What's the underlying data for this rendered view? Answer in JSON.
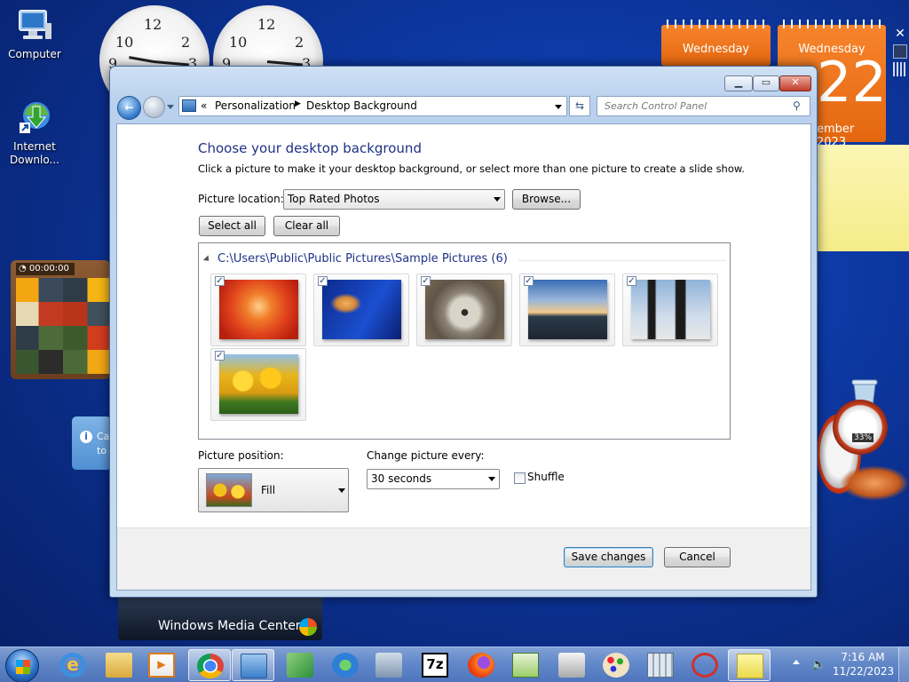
{
  "desktop": {
    "icons": [
      {
        "label_line1": "Computer",
        "label_line2": "",
        "icon": "computer-icon"
      },
      {
        "label_line1": "Internet",
        "label_line2": "Downlo...",
        "icon": "internet-download-manager-icon"
      }
    ],
    "calendar": {
      "small_day": "Wednesday",
      "big_day": "Wednesday",
      "big_date": "22",
      "month_year": "ember 2023"
    },
    "puzzle_timer": "00:00:00",
    "media_center_label": "Windows Media Center",
    "cpu_meter_percent": "33%",
    "gadget_text_fragment": "n",
    "info_fragments": [
      "Ca",
      "to"
    ]
  },
  "window": {
    "nav": {
      "breadcrumb_prefix": "«",
      "crumbs": [
        "Personalization",
        "Desktop Background"
      ],
      "search_placeholder": "Search Control Panel"
    },
    "heading": "Choose your desktop background",
    "instruction": "Click a picture to make it your desktop background, or select more than one picture to create a slide show.",
    "picture_location_label": "Picture location:",
    "picture_location_value": "Top Rated Photos",
    "browse_label": "Browse...",
    "select_all_label": "Select all",
    "clear_all_label": "Clear all",
    "group_header": "C:\\Users\\Public\\Public Pictures\\Sample Pictures (6)",
    "pictures": [
      {
        "name": "chrysanthemum",
        "checked": true
      },
      {
        "name": "jellyfish",
        "checked": true
      },
      {
        "name": "koala",
        "checked": true
      },
      {
        "name": "lighthouse",
        "checked": true
      },
      {
        "name": "penguins",
        "checked": true
      },
      {
        "name": "tulips",
        "checked": true
      }
    ],
    "position_label": "Picture position:",
    "position_value": "Fill",
    "interval_label": "Change picture every:",
    "interval_value": "30 seconds",
    "shuffle_label": "Shuffle",
    "shuffle_checked": false,
    "save_label": "Save changes",
    "cancel_label": "Cancel"
  },
  "taskbar": {
    "apps": [
      "start-orb-icon",
      "internet-explorer-icon",
      "windows-explorer-icon",
      "media-player-icon",
      "chrome-icon",
      "control-panel-icon",
      "system-tools-icon",
      "internet-download-manager-icon",
      "network-icon",
      "7zip-icon",
      "firefox-icon",
      "notepad-plus-icon",
      "printer-icon",
      "paint-icon",
      "calculator-icon",
      "snipping-tool-icon",
      "sticky-notes-icon"
    ],
    "time": "7:16 AM",
    "date": "11/22/2023"
  },
  "colors": {
    "heading": "#1e3287",
    "accent_orange": "#f07824",
    "window_frame": "#b9d1ee"
  }
}
